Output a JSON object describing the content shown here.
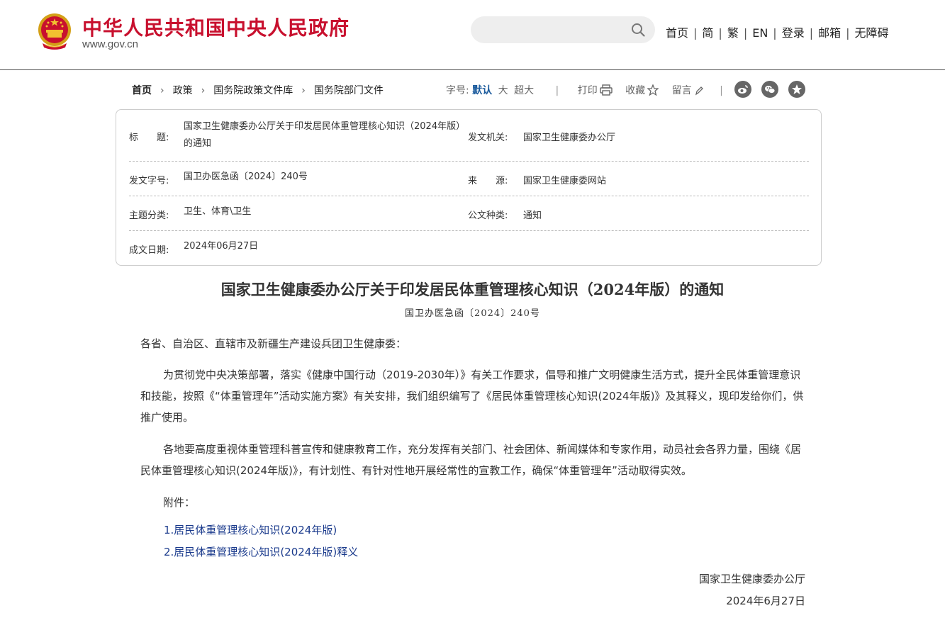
{
  "header": {
    "site_name": "中华人民共和国中央人民政府",
    "site_url": "www.gov.cn",
    "search": {
      "value": "",
      "placeholder": ""
    },
    "nav": [
      "首页",
      "简",
      "繁",
      "EN",
      "登录",
      "邮箱",
      "无障碍"
    ]
  },
  "breadcrumb": [
    "首页",
    "政策",
    "国务院政策文件库",
    "国务院部门文件"
  ],
  "toolbar": {
    "font_label": "字号:",
    "font_sizes": [
      "默认",
      "大",
      "超大"
    ],
    "print": "打印",
    "favorite": "收藏",
    "comment": "留言"
  },
  "info": {
    "title_label": "标　　题:",
    "title_value": "国家卫生健康委办公厅关于印发居民体重管理核心知识（2024年版）的通知",
    "issuer_label": "发文机关:",
    "issuer_value": "国家卫生健康委办公厅",
    "doc_no_label": "发文字号:",
    "doc_no_value": "国卫办医急函〔2024〕240号",
    "source_label": "来　　源:",
    "source_value": "国家卫生健康委网站",
    "topic_label": "主题分类:",
    "topic_value": "卫生、体育\\卫生",
    "type_label": "公文种类:",
    "type_value": "通知",
    "date_label": "成文日期:",
    "date_value": "2024年06月27日"
  },
  "article": {
    "title": "国家卫生健康委办公厅关于印发居民体重管理核心知识（2024年版）的通知",
    "number": "国卫办医急函〔2024〕240号",
    "salutation": "各省、自治区、直辖市及新疆生产建设兵团卫生健康委：",
    "p1": "为贯彻党中央决策部署，落实《健康中国行动（2019-2030年）》有关工作要求，倡导和推广文明健康生活方式，提升全民体重管理意识和技能，按照《“体重管理年”活动实施方案》有关安排，我们组织编写了《居民体重管理核心知识(2024年版)》及其释义，现印发给你们，供推广使用。",
    "p2": "各地要高度重视体重管理科普宣传和健康教育工作，充分发挥有关部门、社会团体、新闻媒体和专家作用，动员社会各界力量，围绕《居民体重管理核心知识(2024年版)》，有计划性、有针对性地开展经常性的宣教工作，确保“体重管理年”活动取得实效。",
    "attachment_label": "附件：",
    "attachments": [
      "1.居民体重管理核心知识(2024年版)",
      "2.居民体重管理核心知识(2024年版)释义"
    ],
    "signature": "国家卫生健康委办公厅",
    "sign_date": "2024年6月27日"
  },
  "colors": {
    "brand_red": "#c8102e",
    "link_blue": "#1a3a8c",
    "accent_blue": "#1a5a9c"
  }
}
